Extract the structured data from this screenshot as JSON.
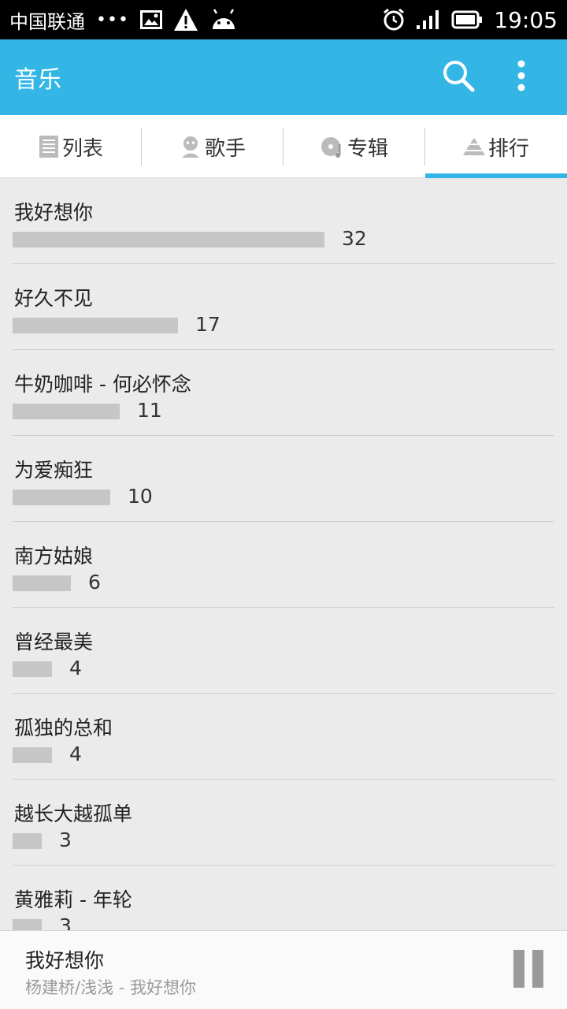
{
  "status_bar": {
    "carrier": "中国联通",
    "dots": "•••",
    "time": "19:05",
    "icons": [
      "image-icon",
      "warning-icon",
      "android-icon",
      "alarm-icon",
      "signal-icon",
      "battery-icon"
    ]
  },
  "action_bar": {
    "title": "音乐",
    "icons": [
      "search-icon",
      "overflow-menu-icon"
    ],
    "color": "#33b5e5"
  },
  "tabs": [
    {
      "label": "列表",
      "icon": "list-icon",
      "active": false
    },
    {
      "label": "歌手",
      "icon": "singer-icon",
      "active": false
    },
    {
      "label": "专辑",
      "icon": "album-icon",
      "active": false
    },
    {
      "label": "排行",
      "icon": "ranking-icon",
      "active": true
    }
  ],
  "ranking": [
    {
      "title": "我好想你",
      "count": "32",
      "value": 32
    },
    {
      "title": "好久不见",
      "count": "17",
      "value": 17
    },
    {
      "title": "牛奶咖啡 - 何必怀念",
      "count": "11",
      "value": 11
    },
    {
      "title": "为爱痴狂",
      "count": "10",
      "value": 10
    },
    {
      "title": "南方姑娘",
      "count": "6",
      "value": 6
    },
    {
      "title": "曾经最美",
      "count": "4",
      "value": 4
    },
    {
      "title": "孤独的总和",
      "count": "4",
      "value": 4
    },
    {
      "title": "越长大越孤单",
      "count": "3",
      "value": 3
    },
    {
      "title": "黄雅莉 - 年轮",
      "count": "3",
      "value": 3
    }
  ],
  "now_playing": {
    "title": "我好想你",
    "subtitle": "杨建桥/浅浅 - 我好想你",
    "state": "playing"
  }
}
